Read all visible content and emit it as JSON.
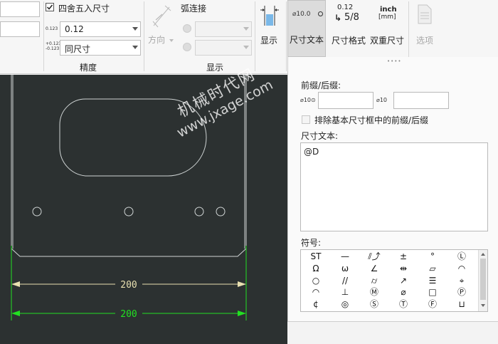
{
  "ribbon": {
    "round_checkbox_label": "四舍五入尺寸",
    "round_checked": true,
    "precision_icon": "0.123",
    "precision_value": "0.12",
    "tolerance_icon_top": "+0.123",
    "tolerance_icon_bottom": "-0.123",
    "tolerance_value": "同尺寸",
    "precision_group_label": "精度",
    "direction_label": "方向",
    "arc_connect_label": "弧连接",
    "display_group_label": "显示",
    "display_button_label": "显示",
    "dim_text_icon": "⌀10.0",
    "dim_text_label": "尺寸文本",
    "dim_format_icon_top": "0.12",
    "dim_format_icon_bottom": "5/8",
    "dim_format_label": "尺寸格式",
    "dual_dim_icon_top": "inch",
    "dual_dim_icon_bottom": "[mm]",
    "dual_dim_label": "双重尺寸",
    "options_label": "选项"
  },
  "popup": {
    "handle": "••••",
    "prefix_suffix_label": "前缀/后缀:",
    "prefix_icon": "⌀10⊙",
    "suffix_icon": "⌀10",
    "prefix_value": "",
    "suffix_value": "",
    "exclude_label": "排除基本尺寸框中的前缀/后缀",
    "exclude_checked": false,
    "dim_text_label": "尺寸文本:",
    "dim_text_value": "@D",
    "symbols_label": "符号:",
    "symbols": [
      [
        "ST",
        "—",
        "⫽⤴",
        "±",
        "°",
        "Ⓛ"
      ],
      [
        "Ω",
        "ω",
        "∠",
        "⇹",
        "▱",
        "◠"
      ],
      [
        "○",
        "//",
        "⌭",
        "↗",
        "☰",
        "⌖"
      ],
      [
        "◠",
        "⊥",
        "Ⓜ",
        "⌀",
        "□",
        "Ⓟ"
      ],
      [
        "¢",
        "◎",
        "Ⓢ",
        "Ⓣ",
        "Ⓕ",
        "⊔"
      ]
    ]
  },
  "drawing": {
    "dim_top_text": "200",
    "dim_bottom_text": "200"
  },
  "watermark": {
    "line1": "机械时代网",
    "line2": "www.jxage.com"
  }
}
